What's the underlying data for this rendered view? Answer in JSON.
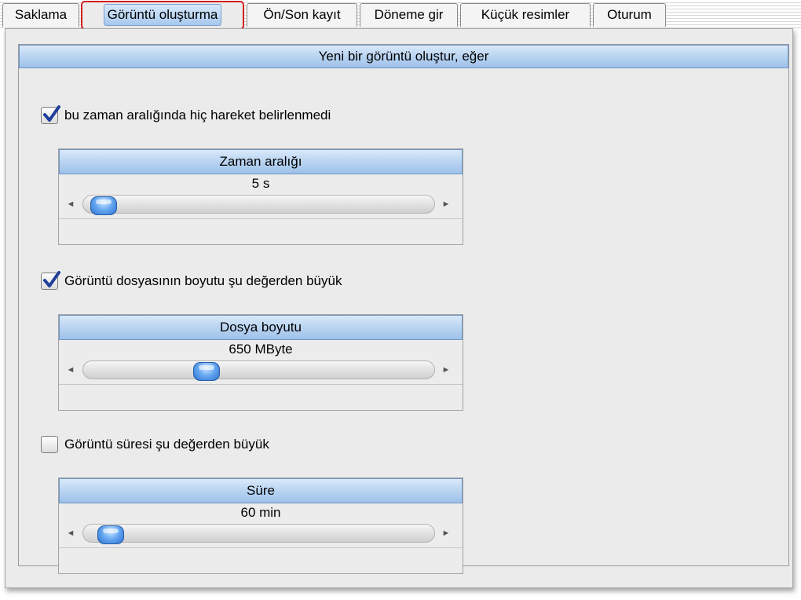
{
  "tabs": [
    {
      "label": "Saklama",
      "active": false
    },
    {
      "label": "Görüntü oluşturma",
      "active": true
    },
    {
      "label": "Ön/Son kayıt",
      "active": false
    },
    {
      "label": "Döneme gir",
      "active": false
    },
    {
      "label": "Küçük resimler",
      "active": false
    },
    {
      "label": "Oturum",
      "active": false
    }
  ],
  "section": {
    "title": "Yeni bir görüntü oluştur, eğer"
  },
  "conditions": [
    {
      "checkbox_label": "bu zaman aralığında hiç hareket belirlenmedi",
      "checked": true,
      "slider_title": "Zaman aralığı",
      "slider_value": "5 s",
      "slider_level": 0.02
    },
    {
      "checkbox_label": "Görüntü dosyasının boyutu şu değerden büyük",
      "checked": true,
      "slider_title": "Dosya boyutu",
      "slider_value": "650 MByte",
      "slider_level": 0.33
    },
    {
      "checkbox_label": "Görüntü süresi şu değerden büyük",
      "checked": false,
      "slider_title": "Süre",
      "slider_value": "60 min",
      "slider_level": 0.05
    }
  ],
  "icons": {
    "checkmark": "check-icon",
    "arrow_left": "arrow-left-icon",
    "arrow_right": "arrow-right-icon"
  },
  "colors": {
    "header_gradient_top": "#d9e9fa",
    "header_gradient_bottom": "#9ec1ea",
    "active_tab_border": "#d21e1e",
    "thumb": "#2b6fcf",
    "check": "#1f3f9a"
  }
}
